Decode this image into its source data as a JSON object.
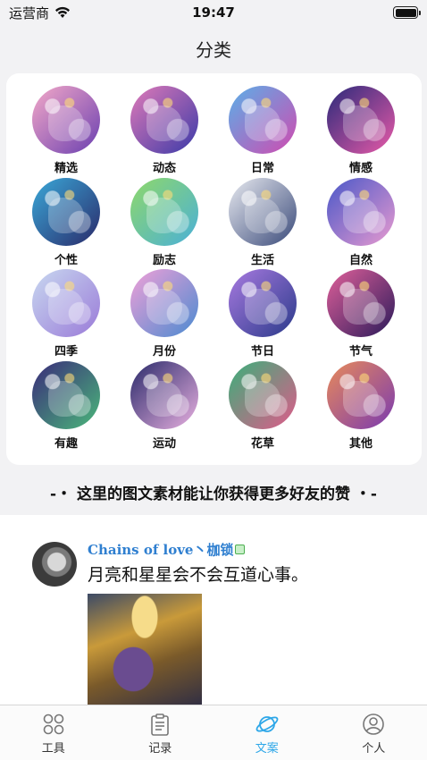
{
  "status": {
    "carrier": "运营商",
    "time": "19:47"
  },
  "header": {
    "title": "分类"
  },
  "categories": [
    {
      "label": "精选",
      "c1": "#f4a9c8",
      "c2": "#6a3fb0"
    },
    {
      "label": "动态",
      "c1": "#e07ab8",
      "c2": "#3a3aa8"
    },
    {
      "label": "日常",
      "c1": "#5ab0e8",
      "c2": "#d04ab0"
    },
    {
      "label": "情感",
      "c1": "#2a2a7a",
      "c2": "#e85aa8"
    },
    {
      "label": "个性",
      "c1": "#3aa8d8",
      "c2": "#2a2a6a"
    },
    {
      "label": "励志",
      "c1": "#8fd86a",
      "c2": "#4ab0d8"
    },
    {
      "label": "生活",
      "c1": "#e8eaf0",
      "c2": "#3a4a7a"
    },
    {
      "label": "自然",
      "c1": "#4a58c8",
      "c2": "#e89ad0"
    },
    {
      "label": "四季",
      "c1": "#c8d8f0",
      "c2": "#9a7ad8"
    },
    {
      "label": "月份",
      "c1": "#f0a0d8",
      "c2": "#4a8ad0"
    },
    {
      "label": "节日",
      "c1": "#a87ae0",
      "c2": "#2a3a8a"
    },
    {
      "label": "节气",
      "c1": "#e0609a",
      "c2": "#2a1a5a"
    },
    {
      "label": "有趣",
      "c1": "#3a2a7a",
      "c2": "#4ab87a"
    },
    {
      "label": "运动",
      "c1": "#2a2a6a",
      "c2": "#e8b0e0"
    },
    {
      "label": "花草",
      "c1": "#3ab07a",
      "c2": "#e05a8a"
    },
    {
      "label": "其他",
      "c1": "#e88a5a",
      "c2": "#7a3ab0"
    }
  ],
  "slogan": "-・ 这里的图文素材能让你获得更多好友的赞 ・-",
  "post": {
    "author": "Chains of love丶枷锁",
    "text": "月亮和星星会不会互道心事。"
  },
  "tabs": [
    {
      "label": "工具",
      "icon": "grid-icon"
    },
    {
      "label": "记录",
      "icon": "clipboard-icon"
    },
    {
      "label": "文案",
      "icon": "planet-icon"
    },
    {
      "label": "个人",
      "icon": "user-icon"
    }
  ],
  "colors": {
    "accent": "#2ea7e8",
    "author": "#2f7fd0"
  }
}
